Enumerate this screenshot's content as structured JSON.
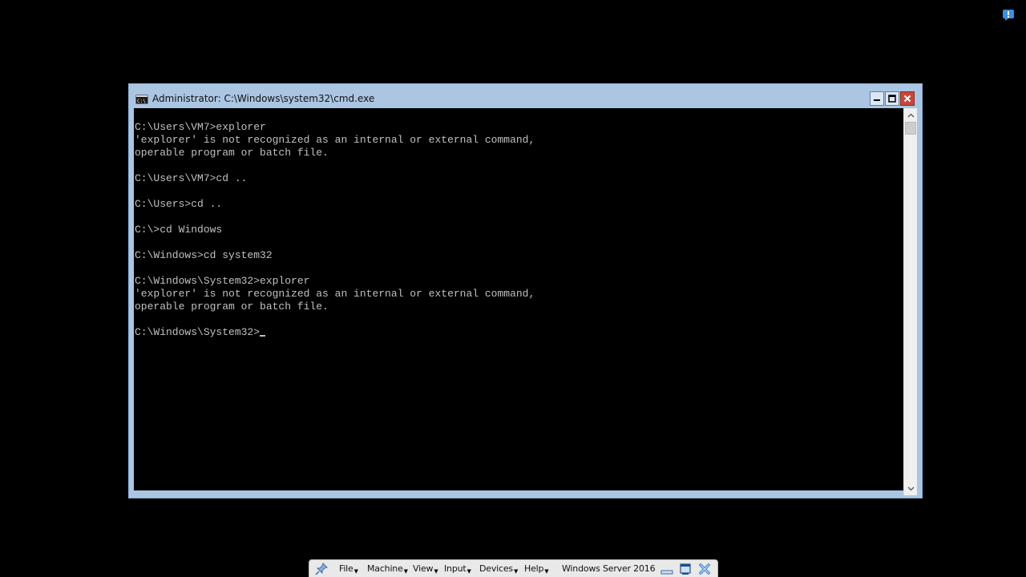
{
  "window": {
    "title": "Administrator: C:\\Windows\\system32\\cmd.exe"
  },
  "console": {
    "lines": [
      "C:\\Users\\VM7>explorer",
      "'explorer' is not recognized as an internal or external command,",
      "operable program or batch file.",
      "",
      "C:\\Users\\VM7>cd ..",
      "",
      "C:\\Users>cd ..",
      "",
      "C:\\>cd Windows",
      "",
      "C:\\Windows>cd system32",
      "",
      "C:\\Windows\\System32>explorer",
      "'explorer' is not recognized as an internal or external command,",
      "operable program or batch file.",
      ""
    ],
    "prompt": "C:\\Windows\\System32>"
  },
  "vbox": {
    "menu": {
      "file": "File",
      "machine": "Machine",
      "view": "View",
      "input": "Input",
      "devices": "Devices",
      "help": "Help"
    },
    "vm_name": "Windows Server 2016",
    "icons": [
      "pin-icon",
      "minimize-icon",
      "restore-icon",
      "close-icon"
    ]
  },
  "colors": {
    "console_bg": "#000000",
    "console_fg": "#c0c0c0",
    "window_frame": "#aac6e3",
    "close_button": "#c9463a"
  }
}
